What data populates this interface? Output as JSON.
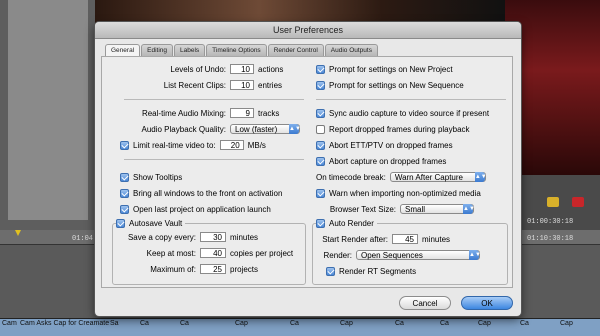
{
  "background": {
    "timecode_left": "01:04",
    "timecode_right": "01:00:30:18",
    "timecode_right2": "01:10:30:18",
    "track_labels": [
      "Cam",
      "Cam Asks Cap for Creamate",
      "Sa",
      "Ca",
      "Ca",
      "Cap",
      "Ca",
      "Cap",
      "Ca",
      "Ca",
      "Cap",
      "Ca",
      "Cap"
    ]
  },
  "dialog": {
    "title": "User Preferences",
    "tabs": [
      "General",
      "Editing",
      "Labels",
      "Timeline Options",
      "Render Control",
      "Audio Outputs"
    ],
    "active_tab": "General",
    "left": {
      "levels_of_undo": {
        "label": "Levels of Undo:",
        "value": "10",
        "unit": "actions"
      },
      "list_recent_clips": {
        "label": "List Recent Clips:",
        "value": "10",
        "unit": "entries"
      },
      "realtime_audio_mixing": {
        "label": "Real-time Audio Mixing:",
        "value": "9",
        "unit": "tracks"
      },
      "audio_playback_quality": {
        "label": "Audio Playback Quality:",
        "value": "Low (faster)"
      },
      "limit_realtime_video": {
        "label": "Limit real-time video to:",
        "value": "20",
        "unit": "MB/s",
        "checked": true
      },
      "show_tooltips": {
        "label": "Show Tooltips",
        "checked": true
      },
      "bring_windows_front": {
        "label": "Bring all windows to the front on activation",
        "checked": true
      },
      "open_last_project": {
        "label": "Open last project on application launch",
        "checked": true
      },
      "autosave_vault": {
        "label": "Autosave Vault",
        "checked": true
      },
      "save_copy_every": {
        "label": "Save a copy every:",
        "value": "30",
        "unit": "minutes"
      },
      "keep_at_most": {
        "label": "Keep at most:",
        "value": "40",
        "unit": "copies per project"
      },
      "maximum_of": {
        "label": "Maximum of:",
        "value": "25",
        "unit": "projects"
      }
    },
    "right": {
      "prompt_new_project": {
        "label": "Prompt for settings on New Project",
        "checked": true
      },
      "prompt_new_sequence": {
        "label": "Prompt for settings on New Sequence",
        "checked": true
      },
      "sync_audio_capture": {
        "label": "Sync audio capture to video source if present",
        "checked": true
      },
      "report_dropped_frames": {
        "label": "Report dropped frames during playback",
        "checked": false
      },
      "abort_ett_ptv": {
        "label": "Abort ETT/PTV on dropped frames",
        "checked": true
      },
      "abort_capture": {
        "label": "Abort capture on dropped frames",
        "checked": true
      },
      "on_timecode_break": {
        "label": "On timecode break:",
        "value": "Warn After Capture"
      },
      "warn_non_optimized": {
        "label": "Warn when importing non-optimized media",
        "checked": true
      },
      "browser_text_size": {
        "label": "Browser Text Size:",
        "value": "Small"
      },
      "auto_render": {
        "label": "Auto Render",
        "checked": true
      },
      "start_render_after": {
        "label": "Start Render after:",
        "value": "45",
        "unit": "minutes"
      },
      "render": {
        "label": "Render:",
        "value": "Open Sequences"
      },
      "render_rt_segments": {
        "label": "Render RT Segments",
        "checked": true
      }
    },
    "buttons": {
      "cancel": "Cancel",
      "ok": "OK"
    }
  }
}
